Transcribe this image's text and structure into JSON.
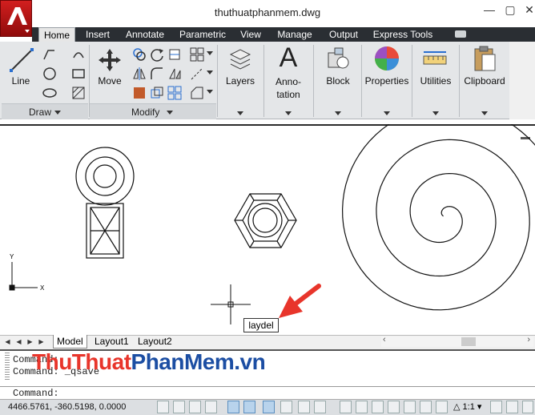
{
  "window": {
    "title": "thuthuatphanmem.dwg"
  },
  "ribbon": {
    "tabs": [
      "Home",
      "Insert",
      "Annotate",
      "Parametric",
      "View",
      "Manage",
      "Output",
      "Express Tools"
    ],
    "active_tab": "Home",
    "draw_panel": {
      "line_label": "Line",
      "footer": "Draw"
    },
    "modify_panel": {
      "move_label": "Move",
      "footer": "Modify"
    },
    "big_buttons": [
      {
        "label": "Layers",
        "icon": "layers-icon"
      },
      {
        "label": "Anno-\ntation",
        "icon": "annotation-icon"
      },
      {
        "label": "Block",
        "icon": "block-icon"
      },
      {
        "label": "Properties",
        "icon": "properties-icon"
      },
      {
        "label": "Utilities",
        "icon": "utilities-icon"
      },
      {
        "label": "Clipboard",
        "icon": "clipboard-icon"
      }
    ]
  },
  "canvas": {
    "ucs_x": "X",
    "ucs_y": "Y",
    "tooltip": "laydel"
  },
  "layout_tabs": [
    "Model",
    "Layout1",
    "Layout2"
  ],
  "active_layout": "Model",
  "command": {
    "history": [
      "Command:",
      "Command: _qsave"
    ],
    "prompt": "Command:"
  },
  "status": {
    "coordinates": "4466.5761, -360.5198, 0.0000",
    "scale": "1:1"
  },
  "watermark": {
    "part1": "ThuThuat",
    "part2": "PhanMem",
    "part3": ".vn"
  },
  "colors": {
    "app_red": "#c8151b",
    "tab_bar": "#2a2e33",
    "ribbon_bg": "#e4e6e8",
    "arrow": "#e8352b"
  }
}
